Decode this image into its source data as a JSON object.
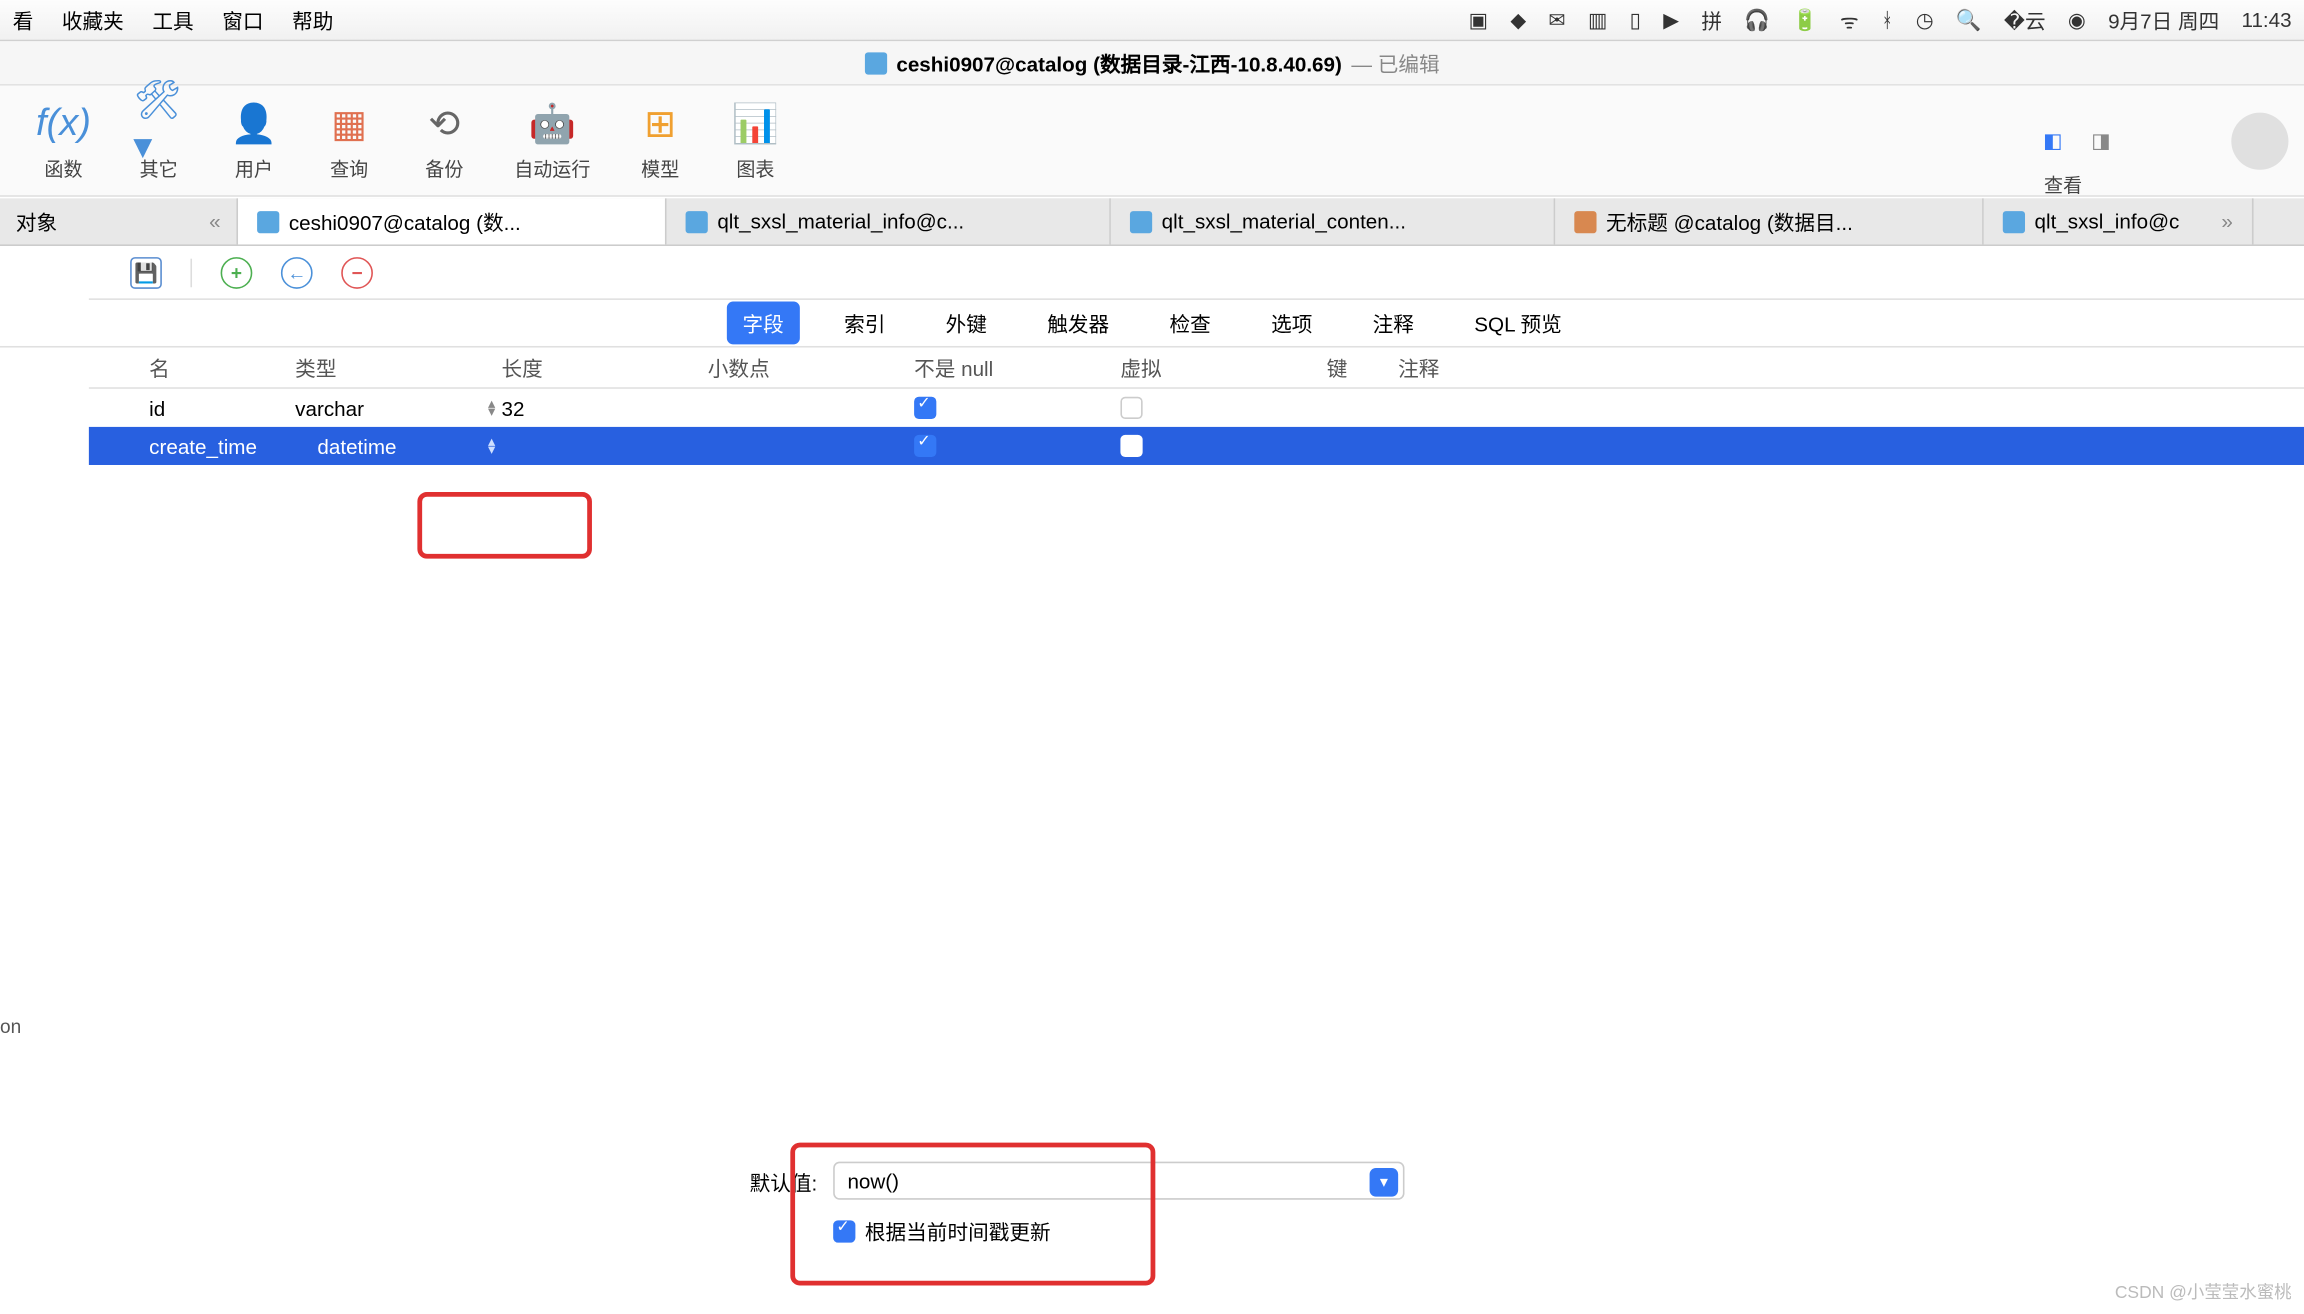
{
  "menubar": {
    "items": [
      "看",
      "收藏夹",
      "工具",
      "窗口",
      "帮助"
    ],
    "date": "9月7日 周四",
    "time": "11:43"
  },
  "title": {
    "text": "ceshi0907@catalog (数据目录-江西-10.8.40.69)",
    "edited": "— 已编辑"
  },
  "toolbar": {
    "items": [
      {
        "icon": "fx",
        "label": "函数",
        "color": "#4a90d9"
      },
      {
        "icon": "⚙",
        "label": "其它",
        "color": "#4a90d9"
      },
      {
        "icon": "👤",
        "label": "用户",
        "color": "#e0a050"
      },
      {
        "icon": "▦",
        "label": "查询",
        "color": "#e07050"
      },
      {
        "icon": "⟳",
        "label": "备份",
        "color": "#888"
      },
      {
        "icon": "🤖",
        "label": "自动运行",
        "color": "#60c080"
      },
      {
        "icon": "⊞",
        "label": "模型",
        "color": "#f0a030"
      },
      {
        "icon": "📊",
        "label": "图表",
        "color": "#a060d0"
      }
    ],
    "view": "查看"
  },
  "tabs": {
    "obj": "对象",
    "items": [
      {
        "label": "ceshi0907@catalog (数...",
        "active": true,
        "type": "t"
      },
      {
        "label": "qlt_sxsl_material_info@c...",
        "type": "t"
      },
      {
        "label": "qlt_sxsl_material_conten...",
        "type": "t"
      },
      {
        "label": "无标题 @catalog (数据目...",
        "type": "q"
      },
      {
        "label": "qlt_sxsl_info@c",
        "type": "t"
      }
    ]
  },
  "subtabs": [
    "字段",
    "索引",
    "外键",
    "触发器",
    "检查",
    "选项",
    "注释",
    "SQL 预览"
  ],
  "columns": {
    "name": "名",
    "type": "类型",
    "length": "长度",
    "decimal": "小数点",
    "notnull": "不是 null",
    "virtual": "虚拟",
    "key": "键",
    "comment": "注释"
  },
  "rows": [
    {
      "name": "id",
      "type": "varchar",
      "length": "32",
      "notnull": true,
      "virtual": false,
      "selected": false
    },
    {
      "name": "create_time",
      "type": "datetime",
      "length": "",
      "notnull": true,
      "virtual": false,
      "selected": true
    }
  ],
  "bottom": {
    "default_label": "默认值:",
    "default_value": "now()",
    "update_ts": "根据当前时间戳更新",
    "update_checked": true
  },
  "leftcut": "on",
  "watermark": "CSDN @小莹莹水蜜桃"
}
